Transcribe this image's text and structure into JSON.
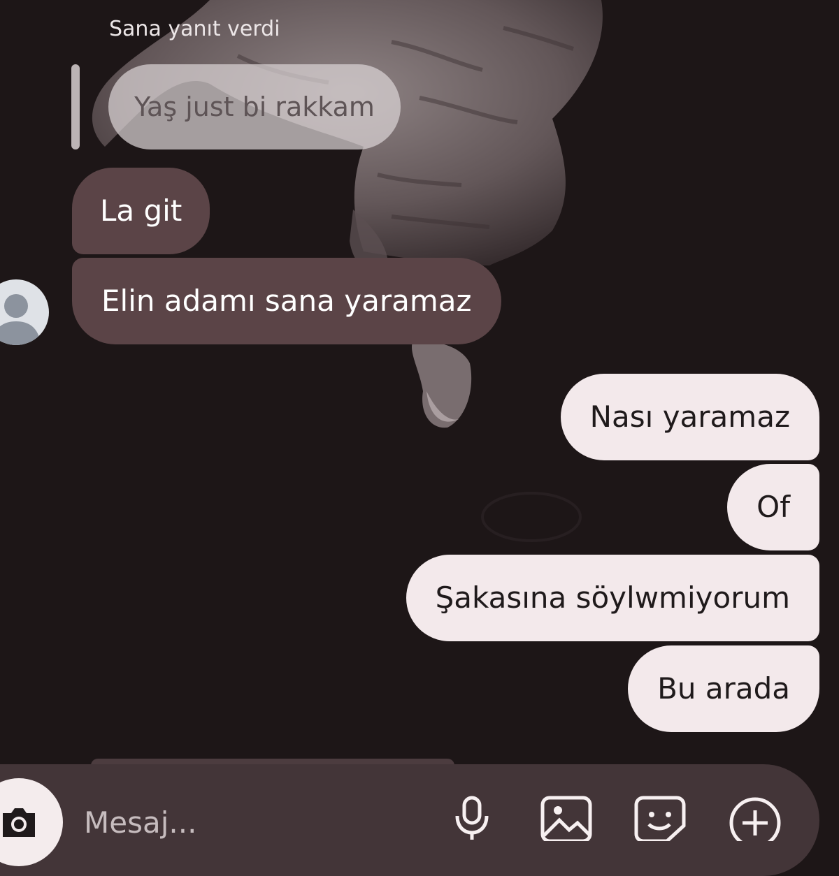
{
  "chat": {
    "reply_caption": "Sana yanıt verdi",
    "quoted_message": "Yaş just bi rakkam",
    "incoming": [
      {
        "text": "La git"
      },
      {
        "text": "Elin adamı sana yaramaz"
      }
    ],
    "outgoing": [
      {
        "text": "Nası yaramaz"
      },
      {
        "text": "Of"
      },
      {
        "text": "Şakasına söylwmiyorum"
      },
      {
        "text": "Bu arada"
      }
    ]
  },
  "composer": {
    "placeholder": "Mesaj...",
    "icons": [
      "camera-icon",
      "microphone-icon",
      "gallery-icon",
      "sticker-icon",
      "plus-icon"
    ]
  },
  "colors": {
    "background": "#1d1617",
    "incoming_bubble": "#5b4447",
    "outgoing_bubble": "#f3e9eb",
    "quoted_bubble": "#dad2d4",
    "composer_bar": "#433538"
  }
}
